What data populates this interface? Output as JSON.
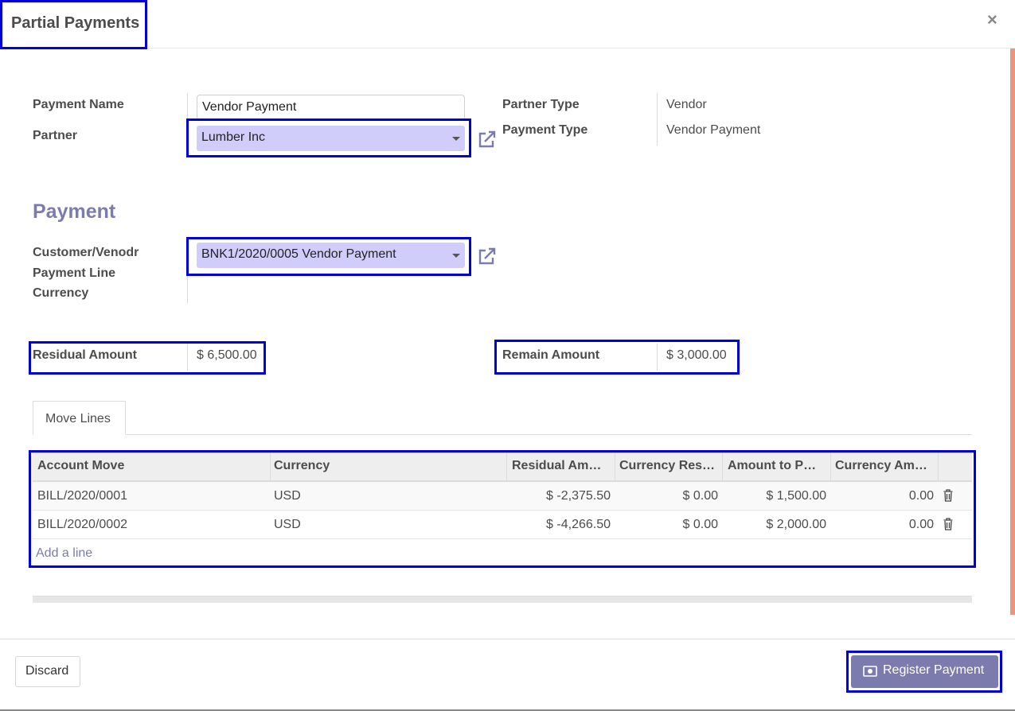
{
  "dialog": {
    "title": "Partial Payments",
    "close_label": "×"
  },
  "form": {
    "payment_name": {
      "label": "Payment Name",
      "value": "Vendor Payment"
    },
    "partner": {
      "label": "Partner",
      "value": "Lumber Inc"
    },
    "partner_type": {
      "label": "Partner Type",
      "value": "Vendor"
    },
    "payment_type": {
      "label": "Payment Type",
      "value": "Vendor Payment"
    }
  },
  "payment_section": {
    "title": "Payment",
    "payment_line": {
      "label_line1": "Customer/Venodr",
      "label_line2": "Payment Line",
      "value": "BNK1/2020/0005 Vendor Payment"
    },
    "currency": {
      "label": "Currency",
      "value": ""
    },
    "residual_amount": {
      "label": "Residual Amount",
      "value": "$ 6,500.00"
    },
    "remain_amount": {
      "label": "Remain Amount",
      "value": "$ 3,000.00"
    }
  },
  "tabs": [
    {
      "label": "Move Lines",
      "active": true
    }
  ],
  "table": {
    "columns": [
      "Account Move",
      "Currency",
      "Residual Am…",
      "Currency Res…",
      "Amount to P…",
      "Currency Am…"
    ],
    "rows": [
      {
        "account_move": "BILL/2020/0001",
        "currency": "USD",
        "residual": "$ -2,375.50",
        "currency_residual": "$ 0.00",
        "amount_to_pay": "$ 1,500.00",
        "currency_amount": "0.00"
      },
      {
        "account_move": "BILL/2020/0002",
        "currency": "USD",
        "residual": "$ -4,266.50",
        "currency_residual": "$ 0.00",
        "amount_to_pay": "$ 2,000.00",
        "currency_amount": "0.00"
      }
    ],
    "add_line_label": "Add a line"
  },
  "footer": {
    "discard_label": "Discard",
    "register_label": "Register Payment"
  },
  "colors": {
    "accent": "#7c7bad",
    "highlight_box": "#0000d8",
    "select_bg": "#d0cdfa",
    "scroll_accent": "#e8967d"
  },
  "icons": {
    "close": "close-icon",
    "external_link": "external-link-icon",
    "trash": "trash-icon",
    "money": "money-icon",
    "caret": "caret-down-icon"
  }
}
